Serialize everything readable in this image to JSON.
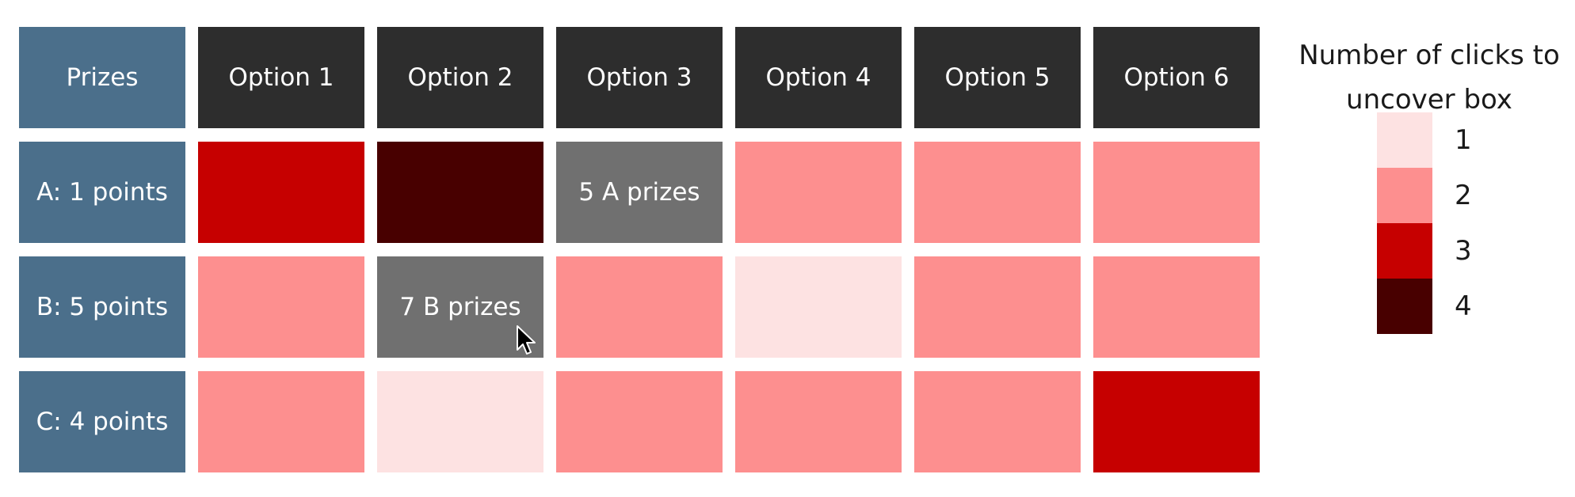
{
  "grid": {
    "corner_label": "Prizes",
    "columns": [
      "Option 1",
      "Option 2",
      "Option 3",
      "Option 4",
      "Option 5",
      "Option 6"
    ],
    "rows": [
      {
        "label": "A: 1 points",
        "cells": [
          {
            "clicks": 3,
            "revealed": false,
            "text": ""
          },
          {
            "clicks": 4,
            "revealed": false,
            "text": ""
          },
          {
            "clicks": null,
            "revealed": true,
            "text": "5 A prizes"
          },
          {
            "clicks": 2,
            "revealed": false,
            "text": ""
          },
          {
            "clicks": 2,
            "revealed": false,
            "text": ""
          },
          {
            "clicks": 2,
            "revealed": false,
            "text": ""
          }
        ]
      },
      {
        "label": "B: 5 points",
        "cells": [
          {
            "clicks": 2,
            "revealed": false,
            "text": ""
          },
          {
            "clicks": null,
            "revealed": true,
            "text": "7 B prizes"
          },
          {
            "clicks": 2,
            "revealed": false,
            "text": ""
          },
          {
            "clicks": 1,
            "revealed": false,
            "text": ""
          },
          {
            "clicks": 2,
            "revealed": false,
            "text": ""
          },
          {
            "clicks": 2,
            "revealed": false,
            "text": ""
          }
        ]
      },
      {
        "label": "C: 4 points",
        "cells": [
          {
            "clicks": 2,
            "revealed": false,
            "text": ""
          },
          {
            "clicks": 1,
            "revealed": false,
            "text": ""
          },
          {
            "clicks": 2,
            "revealed": false,
            "text": ""
          },
          {
            "clicks": 2,
            "revealed": false,
            "text": ""
          },
          {
            "clicks": 2,
            "revealed": false,
            "text": ""
          },
          {
            "clicks": 3,
            "revealed": false,
            "text": ""
          }
        ]
      }
    ]
  },
  "legend": {
    "title": "Number of clicks to\nuncover box",
    "items": [
      {
        "label": "1",
        "color": "#fde2e2"
      },
      {
        "label": "2",
        "color": "#fd8f8f"
      },
      {
        "label": "3",
        "color": "#c60000"
      },
      {
        "label": "4",
        "color": "#480000"
      }
    ]
  },
  "colors": {
    "row_header": "#4b6f8b",
    "column_header": "#2d2d2d",
    "revealed_box": "#707070"
  },
  "cursor": {
    "icon": "mouse-pointer-icon"
  }
}
